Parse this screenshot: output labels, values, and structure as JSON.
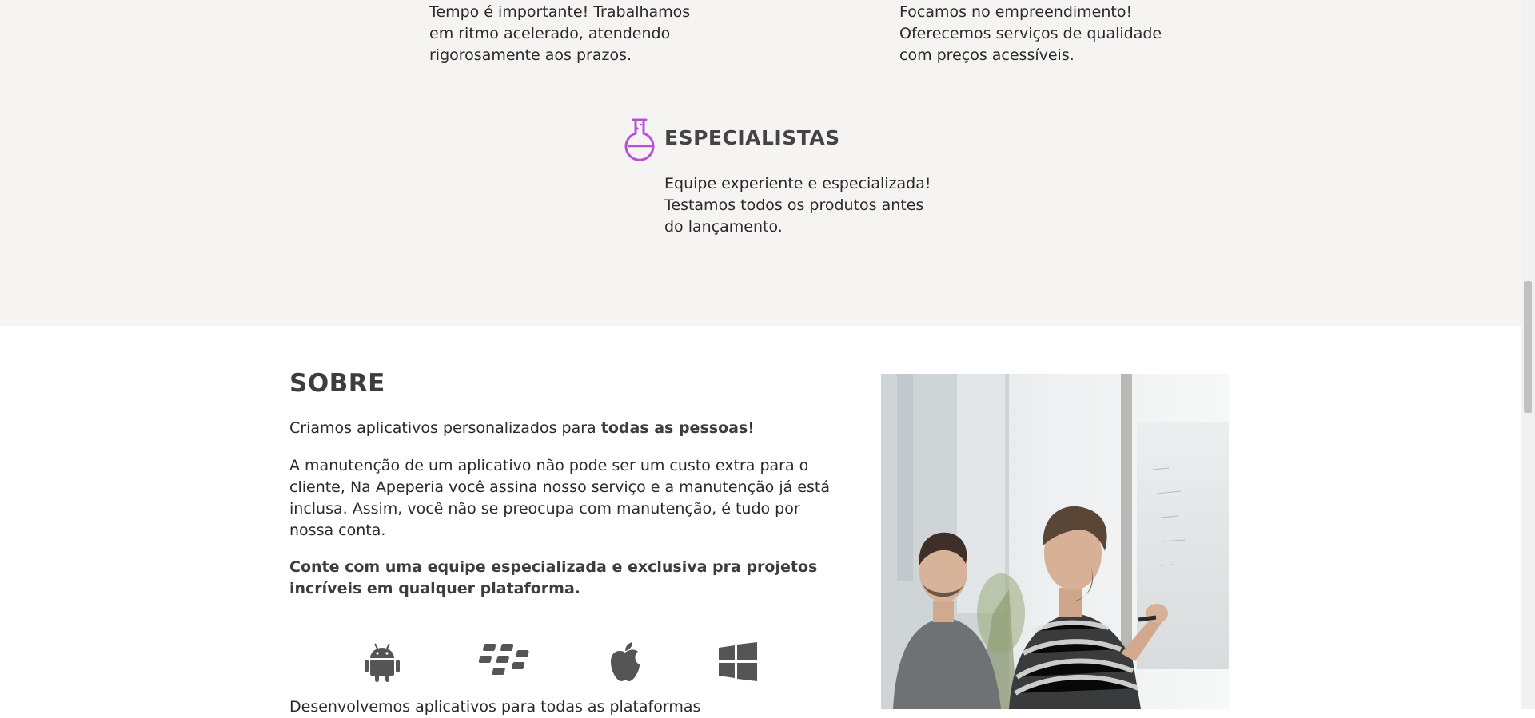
{
  "features": {
    "item_left_text": [
      "Tempo é importante! Trabalhamos",
      "em ritmo acelerado, atendendo",
      "rigorosamente aos prazos."
    ],
    "item_right_text": [
      "Focamos no empreendimento!",
      "Oferecemos serviços de qualidade",
      "com preços acessíveis."
    ],
    "specialists": {
      "icon": "flask-icon",
      "title": "ESPECIALISTAS",
      "text": [
        "Equipe experiente e especializada!",
        "Testamos todos os produtos antes",
        "do lançamento."
      ]
    },
    "accent_color": "#b94fd9"
  },
  "about": {
    "title": "SOBRE",
    "intro_prefix": "Criamos aplicativos personalizados para ",
    "intro_bold": "todas as pessoas",
    "intro_suffix": "!",
    "maintenance": "A manutenção de um aplicativo não pode ser um custo extra para o cliente, Na Apeperia você assina nosso serviço e a manutenção já está inclusa. Assim, você não se preocupa com manutenção, é tudo por nossa conta.",
    "team_bold": "Conte com uma equipe especializada e exclusiva pra projetos incríveis em qualquer plataforma.",
    "platforms": [
      {
        "icon": "android-icon"
      },
      {
        "icon": "blackberry-icon"
      },
      {
        "icon": "apple-icon"
      },
      {
        "icon": "windows-icon"
      }
    ],
    "partial_text": "Desenvolvemos aplicativos para todas as plataformas",
    "photo": "team-whiteboard-photo"
  }
}
